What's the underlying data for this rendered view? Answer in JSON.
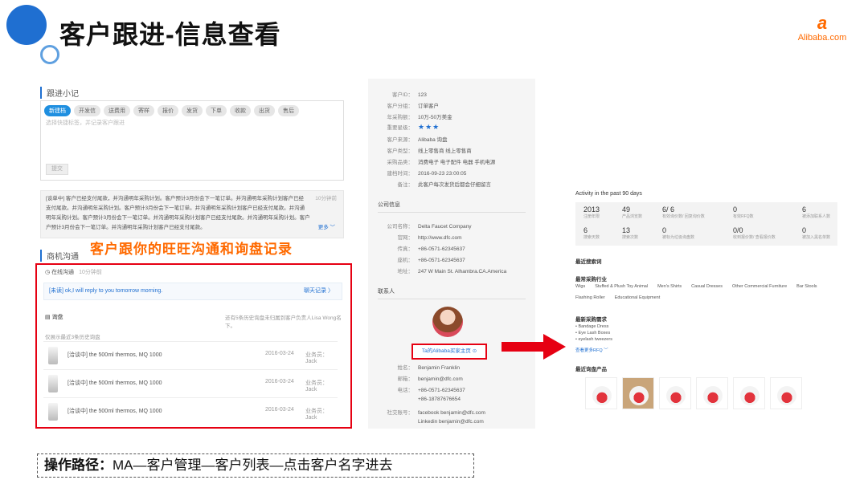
{
  "header": {
    "title": "客户跟进-信息查看",
    "logo_mark": "a",
    "logo_text": "Alibaba.com"
  },
  "notes": {
    "section_label": "跟进小记",
    "tags": [
      "新建档",
      "开发信",
      "送费用",
      "寄样",
      "报价",
      "发货",
      "下单",
      "收款",
      "出货",
      "售后"
    ],
    "placeholder": "选择快捷标签，并记录客户跟进",
    "submit_label": "提交",
    "history_lines": [
      "[谈单中] 客户已经支付尾款，并沟通明年采购计划。客户预计3月份会下一笔订单。并沟通明年采购计划客户已经",
      "支付尾款。并沟通明年采购计划。客户预计3月份会下一笔订单。并沟通明年采购计划客户已经支付尾款。并沟通",
      "明年采购计划。客户预计3月份会下一笔订单。并沟通明年采购计划客户已经支付尾款。并沟通明年采购计划。客户",
      "户预计3月份会下一笔订单。并沟通明年采购计划客户已经支付尾款。"
    ],
    "history_time": "10分钟前",
    "more_label": "更多 ﹀"
  },
  "business": {
    "section_label": "商机沟通",
    "caption": "客户跟你的旺旺沟通和询盘记录",
    "online_label": "在线沟通",
    "online_time": "10分钟前",
    "message": "[未读] ok,I will reply to you tomorrow morning.",
    "chat_link": "聊天记录 〉",
    "inquiry_label": "询盘",
    "inquiry_note": "还有5条历史询盘未归属到客户负责人Lisa Wong名下。",
    "inquiry_sub": "仅展示最近3条历史询盘",
    "inquiries": [
      {
        "title": "[洽谈中] the 500ml thermos, MQ 1000",
        "date": "2016-03-24",
        "owner": "业务员：Jack"
      },
      {
        "title": "[洽谈中] the 500ml thermos, MQ 1000",
        "date": "2016-03-24",
        "owner": "业务员：Jack"
      },
      {
        "title": "[洽谈中] the 500ml thermos, MQ 1000",
        "date": "2016-03-24",
        "owner": "业务员：Jack"
      }
    ]
  },
  "profile": {
    "fields": [
      {
        "k": "客户ID：",
        "v": "123"
      },
      {
        "k": "客户分组：",
        "v": "订单客户"
      },
      {
        "k": "年采购额：",
        "v": "10万-50万美金"
      },
      {
        "k": "重要星级：",
        "v": "★★★"
      },
      {
        "k": "客户来源：",
        "v": "Alibaba 询盘"
      },
      {
        "k": "客户类型：",
        "v": "线上零售商  线上零售商"
      },
      {
        "k": "采购品类：",
        "v": "消费电子  电子配件  电器  手机电源"
      },
      {
        "k": "建档时间：",
        "v": "2016-09-23  23:00:05"
      },
      {
        "k": "备注：",
        "v": "此客户每次发货后都会仔细留言"
      }
    ],
    "company_title": "公司信息",
    "company": [
      {
        "k": "公司名称：",
        "v": "Delta Faucet Company"
      },
      {
        "k": "官网：",
        "v": "http://www.dfc.com"
      },
      {
        "k": "传真：",
        "v": "+86-0571-62345637"
      },
      {
        "k": "座机：",
        "v": "+86-0571-62345637"
      },
      {
        "k": "地址：",
        "v": "247 W Main St. Alhambra.CA.America"
      }
    ],
    "contact_title": "联系人",
    "homepage_label": "Ta的Alibaba买家主页 ⊙",
    "contact": [
      {
        "k": "姓名：",
        "v": "Benjamin Franklin"
      },
      {
        "k": "邮箱：",
        "v": "benjamin@dfc.com"
      },
      {
        "k": "电话：",
        "v": "+86-0571-62345637"
      },
      {
        "k": "",
        "v": "+86-18787676654"
      },
      {
        "k": "社交账号：",
        "v": "facebook  benjamin@dfc.com"
      },
      {
        "k": "",
        "v": "Linkedin  benjamin@dfc.com"
      }
    ]
  },
  "activity": {
    "title": "Activity in the past 90 days",
    "stats": [
      {
        "n": "2013",
        "l": "注册年限"
      },
      {
        "n": "49",
        "l": "产品浏览数"
      },
      {
        "n": "6/ 6",
        "l": "有效询价数/ 回复询价数"
      },
      {
        "n": "0",
        "l": "有效RFQ数"
      },
      {
        "n": "6",
        "l": "被添加联系人数"
      },
      {
        "n": "6",
        "l": "搜索天数"
      },
      {
        "n": "13",
        "l": "搜索次数"
      },
      {
        "n": "0",
        "l": "被标为垃圾询盘数"
      },
      {
        "n": "0/0",
        "l": "收到报价数/ 查看报价数"
      },
      {
        "n": "0",
        "l": "被加入黑名单数"
      }
    ],
    "recent_search": "最近搜索词",
    "industry_title": "最常采购行业",
    "industries": [
      "Wigs",
      "Stuffed & Plush Toy Animal",
      "Men's Shirts",
      "Casual Dresses",
      "Other Commercial Furniture",
      "Bar Stools",
      "Flashing Roller",
      "Educational Equipment"
    ],
    "rfq_title": "最新采购需求",
    "rfqs": [
      "• Bandage Dress",
      "• Eye Lash Boxes",
      "• eyelash tweezers"
    ],
    "rfq_more": "查看更多RFQ ﹀",
    "inquiry_products": "最近询盘产品"
  },
  "footer": {
    "path_label": "操作路径：",
    "path_text": "MA—客户管理—客户列表—点击客户名字进去"
  }
}
